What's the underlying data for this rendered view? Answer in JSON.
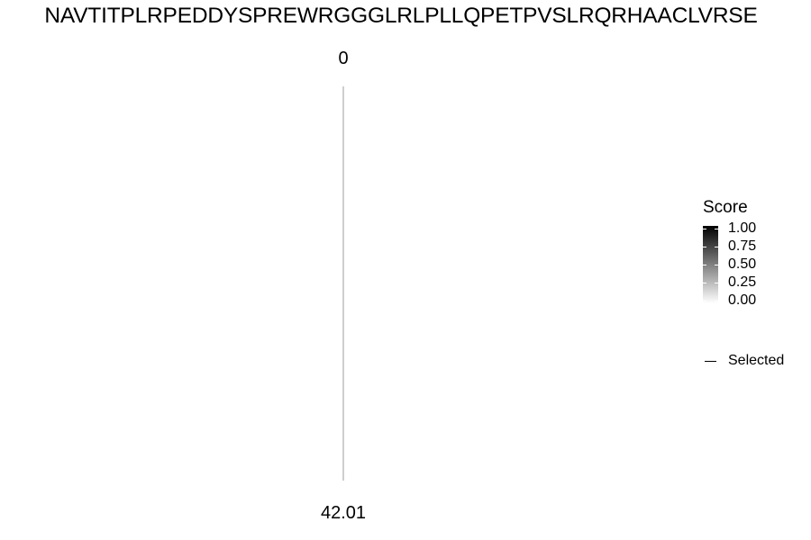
{
  "chart_data": {
    "type": "line",
    "title": "NAVTITPLRPEDDYSPREWRGGGLRLPLLQPETPVSLRQRHAACLVRSE",
    "axis": {
      "top_label": "0",
      "bottom_label": "42.01",
      "range": [
        0,
        42.01
      ]
    },
    "series": [
      {
        "name": "Selected",
        "x": [
          0,
          42.01
        ],
        "color": "#9e9e9e"
      }
    ],
    "color_scale": {
      "name": "Score",
      "min": 0,
      "max": 1,
      "low_color": "#ffffff",
      "high_color": "#000000",
      "ticks": [
        "1.00",
        "0.75",
        "0.50",
        "0.25",
        "0.00"
      ]
    },
    "legend": {
      "position": "right"
    }
  }
}
